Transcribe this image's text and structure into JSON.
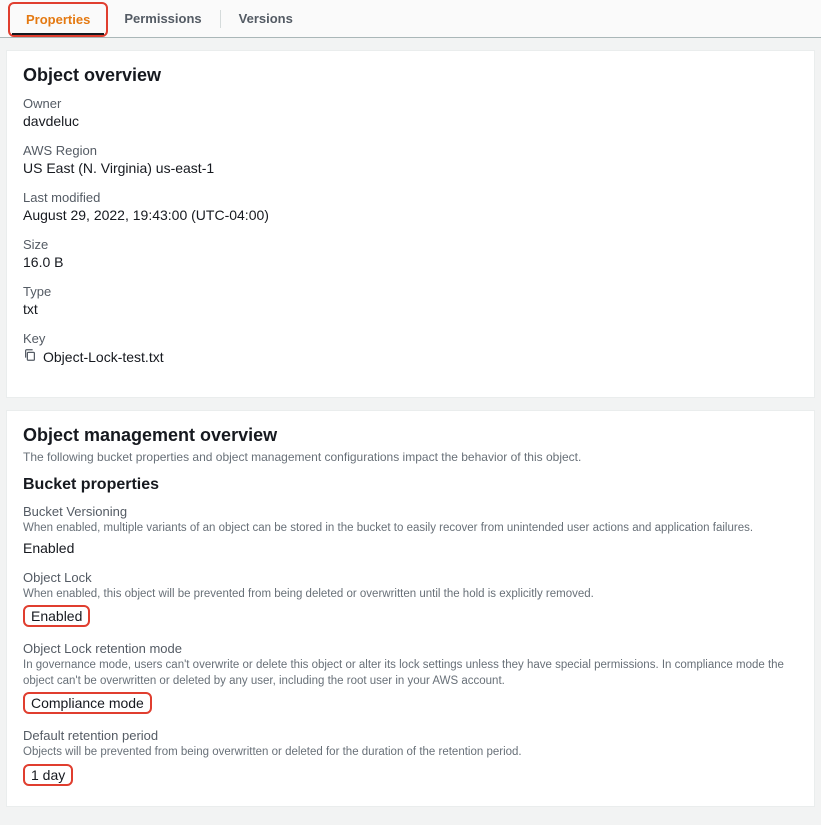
{
  "tabs": {
    "properties": "Properties",
    "permissions": "Permissions",
    "versions": "Versions"
  },
  "overview": {
    "title": "Object overview",
    "owner_label": "Owner",
    "owner_value": "davdeluc",
    "region_label": "AWS Region",
    "region_value": "US East (N. Virginia) us-east-1",
    "modified_label": "Last modified",
    "modified_value": "August 29, 2022, 19:43:00 (UTC-04:00)",
    "size_label": "Size",
    "size_value": "16.0 B",
    "type_label": "Type",
    "type_value": "txt",
    "key_label": "Key",
    "key_value": "Object-Lock-test.txt"
  },
  "management": {
    "title": "Object management overview",
    "subhead": "The following bucket properties and object management configurations impact the behavior of this object.",
    "bucket_props_title": "Bucket properties",
    "versioning_label": "Bucket Versioning",
    "versioning_desc": "When enabled, multiple variants of an object can be stored in the bucket to easily recover from unintended user actions and application failures.",
    "versioning_value": "Enabled",
    "lock_label": "Object Lock",
    "lock_desc": "When enabled, this object will be prevented from being deleted or overwritten until the hold is explicitly removed.",
    "lock_value": "Enabled",
    "retention_mode_label": "Object Lock retention mode",
    "retention_mode_desc": "In governance mode, users can't overwrite or delete this object or alter its lock settings unless they have special permissions. In compliance mode the object can't be overwritten or deleted by any user, including the root user in your AWS account.",
    "retention_mode_value": "Compliance mode",
    "retention_period_label": "Default retention period",
    "retention_period_desc": "Objects will be prevented from being overwritten or deleted for the duration of the retention period.",
    "retention_period_value": "1 day"
  }
}
